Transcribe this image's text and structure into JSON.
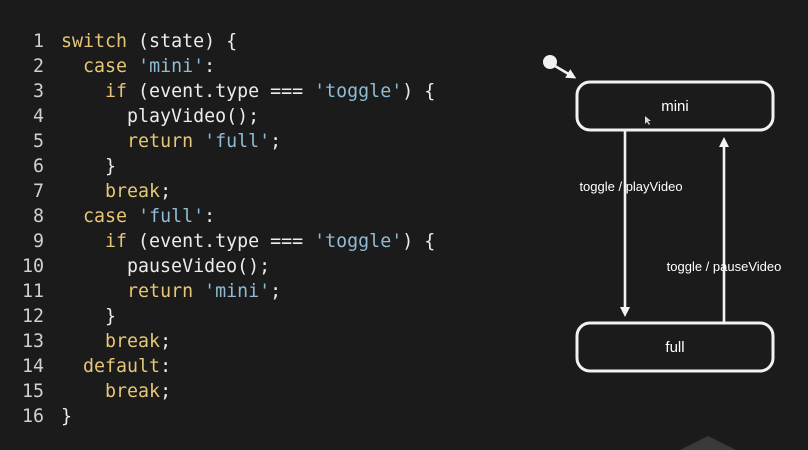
{
  "code": {
    "lines": [
      {
        "n": "1",
        "tokens": [
          {
            "t": "switch",
            "k": "kw"
          },
          {
            "t": " (state) {",
            "k": "pl"
          }
        ]
      },
      {
        "n": "2",
        "tokens": [
          {
            "t": "  ",
            "k": "pl"
          },
          {
            "t": "case",
            "k": "kw"
          },
          {
            "t": " ",
            "k": "pl"
          },
          {
            "t": "'mini'",
            "k": "str"
          },
          {
            "t": ":",
            "k": "pl"
          }
        ]
      },
      {
        "n": "3",
        "tokens": [
          {
            "t": "    ",
            "k": "pl"
          },
          {
            "t": "if",
            "k": "kw"
          },
          {
            "t": " (event.type === ",
            "k": "pl"
          },
          {
            "t": "'toggle'",
            "k": "str"
          },
          {
            "t": ") {",
            "k": "pl"
          }
        ]
      },
      {
        "n": "4",
        "tokens": [
          {
            "t": "      playVideo();",
            "k": "pl"
          }
        ]
      },
      {
        "n": "5",
        "tokens": [
          {
            "t": "      ",
            "k": "pl"
          },
          {
            "t": "return",
            "k": "kw"
          },
          {
            "t": " ",
            "k": "pl"
          },
          {
            "t": "'full'",
            "k": "str"
          },
          {
            "t": ";",
            "k": "pl"
          }
        ]
      },
      {
        "n": "6",
        "tokens": [
          {
            "t": "    }",
            "k": "pl"
          }
        ]
      },
      {
        "n": "7",
        "tokens": [
          {
            "t": "    ",
            "k": "pl"
          },
          {
            "t": "break",
            "k": "kw"
          },
          {
            "t": ";",
            "k": "pl"
          }
        ]
      },
      {
        "n": "8",
        "tokens": [
          {
            "t": "  ",
            "k": "pl"
          },
          {
            "t": "case",
            "k": "kw"
          },
          {
            "t": " ",
            "k": "pl"
          },
          {
            "t": "'full'",
            "k": "str"
          },
          {
            "t": ":",
            "k": "pl"
          }
        ]
      },
      {
        "n": "9",
        "tokens": [
          {
            "t": "    ",
            "k": "pl"
          },
          {
            "t": "if",
            "k": "kw"
          },
          {
            "t": " (event.type === ",
            "k": "pl"
          },
          {
            "t": "'toggle'",
            "k": "str"
          },
          {
            "t": ") {",
            "k": "pl"
          }
        ]
      },
      {
        "n": "10",
        "tokens": [
          {
            "t": "      pauseVideo();",
            "k": "pl"
          }
        ]
      },
      {
        "n": "11",
        "tokens": [
          {
            "t": "      ",
            "k": "pl"
          },
          {
            "t": "return",
            "k": "kw"
          },
          {
            "t": " ",
            "k": "pl"
          },
          {
            "t": "'mini'",
            "k": "str"
          },
          {
            "t": ";",
            "k": "pl"
          }
        ]
      },
      {
        "n": "12",
        "tokens": [
          {
            "t": "    }",
            "k": "pl"
          }
        ]
      },
      {
        "n": "13",
        "tokens": [
          {
            "t": "    ",
            "k": "pl"
          },
          {
            "t": "break",
            "k": "kw"
          },
          {
            "t": ";",
            "k": "pl"
          }
        ]
      },
      {
        "n": "14",
        "tokens": [
          {
            "t": "  ",
            "k": "pl"
          },
          {
            "t": "default",
            "k": "kw"
          },
          {
            "t": ":",
            "k": "pl"
          }
        ]
      },
      {
        "n": "15",
        "tokens": [
          {
            "t": "    ",
            "k": "pl"
          },
          {
            "t": "break",
            "k": "kw"
          },
          {
            "t": ";",
            "k": "pl"
          }
        ]
      },
      {
        "n": "16",
        "tokens": [
          {
            "t": "}",
            "k": "pl"
          }
        ]
      }
    ]
  },
  "diagram": {
    "states": {
      "mini": "mini",
      "full": "full"
    },
    "transitions": {
      "mini_to_full": "toggle / playVideo",
      "full_to_mini": "toggle / pauseVideo"
    }
  },
  "colors": {
    "background": "#1b1b1b",
    "keyword": "#e6c777",
    "string": "#8fbcd4",
    "plain": "#ececec",
    "line_number": "#d0d0d0",
    "diagram_stroke": "#f2f2f2"
  }
}
